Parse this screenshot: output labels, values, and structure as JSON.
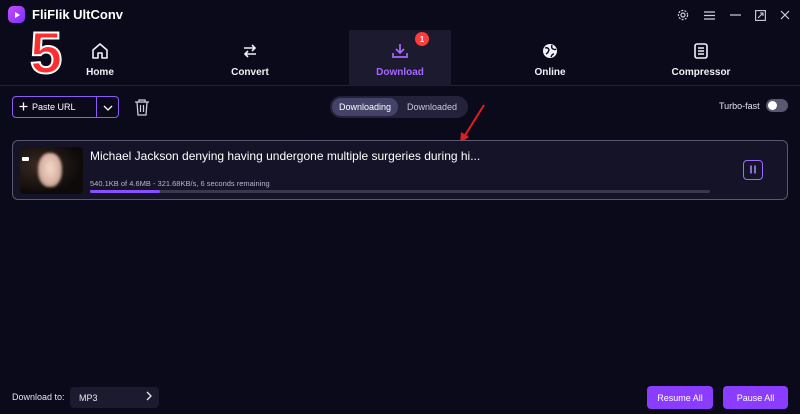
{
  "app": {
    "title": "FliFlik UltConv",
    "brand_color": "#8b3dff",
    "background": "#0b0a1a"
  },
  "window_controls": [
    {
      "name": "settings-icon"
    },
    {
      "name": "menu-icon"
    },
    {
      "name": "minimize-icon"
    },
    {
      "name": "maximize-icon"
    },
    {
      "name": "close-icon"
    }
  ],
  "annotation": {
    "step_number": "5",
    "color": "#ff2d2d"
  },
  "nav": {
    "tabs": [
      {
        "label": "Home",
        "icon": "home-icon",
        "active": false
      },
      {
        "label": "Convert",
        "icon": "convert-icon",
        "active": false
      },
      {
        "label": "Download",
        "icon": "download-icon",
        "active": true,
        "badge": "1"
      },
      {
        "label": "Online",
        "icon": "globe-icon",
        "active": false
      },
      {
        "label": "Compressor",
        "icon": "compressor-icon",
        "active": false
      }
    ]
  },
  "toolbar": {
    "paste_url_label": "Paste URL",
    "segments": [
      {
        "label": "Downloading",
        "active": true
      },
      {
        "label": "Downloaded",
        "active": false
      }
    ],
    "turbo_label": "Turbo-fast",
    "turbo_enabled": false
  },
  "downloads": [
    {
      "title": "Michael Jackson denying having undergone multiple surgeries during hi...",
      "status": "540.1KB of 4.6MB -  321.68KB/s, 6 seconds remaining",
      "progress": 0.113
    }
  ],
  "footer": {
    "download_to_label": "Download to:",
    "format": "MP3",
    "resume_all": "Resume All",
    "pause_all": "Pause All"
  }
}
